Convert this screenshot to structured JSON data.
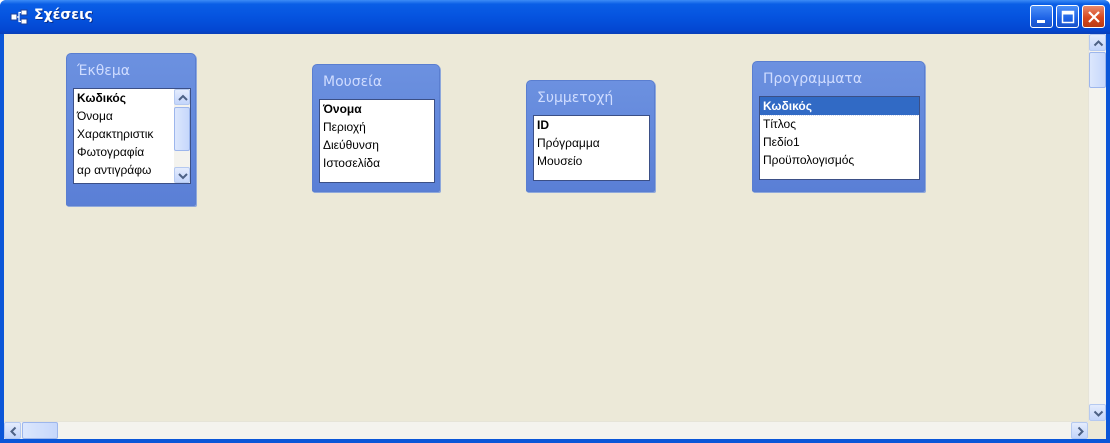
{
  "window": {
    "title": "Σχέσεις",
    "minimize_icon": "minimize-icon",
    "maximize_icon": "maximize-icon",
    "close_icon": "close-icon"
  },
  "tables": [
    {
      "title": "Έκθεμα",
      "fields": [
        "Κωδικός",
        "Όνομα",
        "Χαρακτηριστικ",
        "Φωτογραφία",
        "αρ αντιγράφω"
      ],
      "key_fields": [
        0
      ],
      "selected": null,
      "has_scrollbar": true
    },
    {
      "title": "Μουσεία",
      "fields": [
        "Όνομα",
        "Περιοχή",
        "Διεύθυνση",
        "Ιστοσελίδα"
      ],
      "key_fields": [
        0
      ],
      "selected": null,
      "has_scrollbar": false
    },
    {
      "title": "Συμμετοχή",
      "fields": [
        "ID",
        "Πρόγραμμα",
        "Μουσείο"
      ],
      "key_fields": [
        0
      ],
      "selected": null,
      "has_scrollbar": false
    },
    {
      "title": "Προγραμματα",
      "fields": [
        "Κωδικός",
        "Τίτλος",
        "Πεδίο1",
        "Προϋπολογισμός"
      ],
      "key_fields": [
        0
      ],
      "selected": 0,
      "has_scrollbar": false
    }
  ],
  "colors": {
    "titlebar": "#0553df",
    "canvas": "#ece9d8",
    "table_header": "#6c91e0",
    "selection": "#316ac5"
  }
}
